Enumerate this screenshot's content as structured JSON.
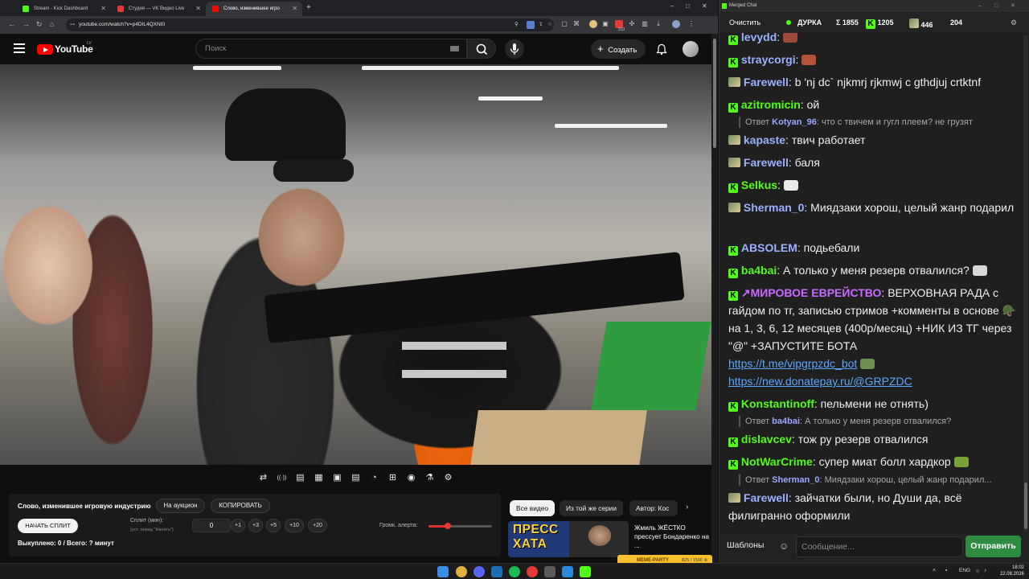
{
  "browser": {
    "tabs": [
      {
        "title": "Stream - Kick Dashboard",
        "active": false,
        "color": "#53fc18"
      },
      {
        "title": "Студия — VK Видео Live",
        "active": false,
        "color": "#e53935"
      },
      {
        "title": "Слово, изменившее игро",
        "active": true,
        "color": "#ff0000"
      }
    ],
    "new_tab": "+",
    "url": "youtube.com/watch?v=p4DIL4QXNI0",
    "extension_badge": "313",
    "window_controls": [
      "–",
      "□",
      "✕"
    ]
  },
  "youtube": {
    "logo_text": "YouTube",
    "country_code": "LV",
    "search_placeholder": "Поиск",
    "create_label": "Создать",
    "create_icon": "+",
    "icons": {
      "menu": "menu-icon",
      "search": "search-icon",
      "mic": "mic-icon",
      "bell": "bell-icon"
    }
  },
  "controls": [
    "⇄",
    "((·))",
    "▤",
    "▦",
    "▣",
    "▤",
    "◔",
    "⊞",
    "◉",
    "⚗",
    "⚙"
  ],
  "panel": {
    "title": "Слово, изменившее игровую индустрию",
    "auction_label": "На аукцион",
    "copy_label": "КОПИРОВАТЬ",
    "start_split_label": "НАЧАТЬ СПЛИТ",
    "split_label": "Сплит (мин):",
    "split_hint": "(уст. перед \"Начать\")",
    "split_value": "0",
    "steps": [
      "+1",
      "+3",
      "+5",
      "+10",
      "+20"
    ],
    "volume_label": "Громк. алерта:",
    "volume_level": 0.31,
    "done_text": "Выкуплено: 0 / Всего: ? минут"
  },
  "recommendations": {
    "chips": [
      "Все видео",
      "Из той же серии",
      "Автор: Кос"
    ],
    "next": "›",
    "thumb_text_line1": "ПРЕСС",
    "thumb_text_line2": "ХАТА",
    "video_title": "Жмиль ЖЁСТКО прессует Бондаренко на ...",
    "ad_text": "MEME-PARTY",
    "ad_count": "825 / 1500 ⊚"
  },
  "chat": {
    "window_title": "Merged Chat",
    "clear_label": "Очистить",
    "channel_name": "ДУРКА",
    "total": "Σ 1855",
    "kick_count": "1205",
    "yt_count": "446",
    "other_count": "204",
    "templates_label": "Шаблоны",
    "input_placeholder": "Сообщение...",
    "send_label": "Отправить",
    "messages": [
      {
        "platform": "kick",
        "user": "levydd",
        "text": "",
        "emote": "#c0392b"
      },
      {
        "platform": "kick",
        "user": "straycorgi",
        "text": "",
        "emote": "#b5523a"
      },
      {
        "platform": "yt",
        "user": "Farewell",
        "text": "b 'nj dc` njkmrj rjkmwj c gthdjuj crtktnf"
      },
      {
        "platform": "kick",
        "user": "azitromicin",
        "text": "ой",
        "reply_user": "Kotyan_96",
        "reply_text": "что с твичем и гугл плеем? не грузят"
      },
      {
        "platform": "yt",
        "user": "kapaste",
        "text": "твич работает"
      },
      {
        "platform": "yt",
        "user": "Farewell",
        "text": "баля"
      },
      {
        "platform": "kick",
        "user": "Selkus",
        "text": "",
        "emote": "#e9e9e9"
      },
      {
        "platform": "yt",
        "user": "Sherman_0",
        "text": "Миядзаки хорош, целый жанр подарил"
      },
      {
        "platform": "kick",
        "user": "ABSOLEM",
        "text": "подьебали"
      },
      {
        "platform": "kick",
        "user": "ba4bai",
        "text": "А только у меня резерв отвалился?"
      },
      {
        "platform": "kick",
        "user": "↗МИРОВОЕ ЕВРЕЙСТВО",
        "text": "ВЕРХОВНАЯ РАДА с гайдом по тг, записью стримов +комменты в основе 🪖 на 1, 3, 6, 12 месяцев (400р/месяц) +НИК ИЗ ТГ через \"@\" +ЗАПУСТИТЕ БОТА",
        "link1": "https://t.me/vipgrpzdc_bot",
        "link2": "https://new.donatepay.ru/@GRPZDC"
      },
      {
        "platform": "kick",
        "user": "Konstantinoff",
        "text": "пельмени не отнять)",
        "reply_user": "ba4bai",
        "reply_text": "А только у меня резерв отвалился?"
      },
      {
        "platform": "kick",
        "user": "dislavcev",
        "text": "тож ру резерв отвалился"
      },
      {
        "platform": "kick",
        "user": "NotWarCrime",
        "text": "супер миат болл хардкор",
        "reply_user": "Sherman_0",
        "reply_text": "Миядзаки хорош, целый жанр подарил..."
      },
      {
        "platform": "yt",
        "user": "Farewell",
        "text": "зайчатки были, но Души да, всё филигранно оформили"
      }
    ],
    "colors": {
      "kick": "#53fc18",
      "yt_name": "#9bb1ff",
      "cyan_name": "#5fd7ff"
    }
  },
  "taskbar": {
    "lang": "ENG",
    "time": "18:02",
    "date": "22.08.2026"
  }
}
